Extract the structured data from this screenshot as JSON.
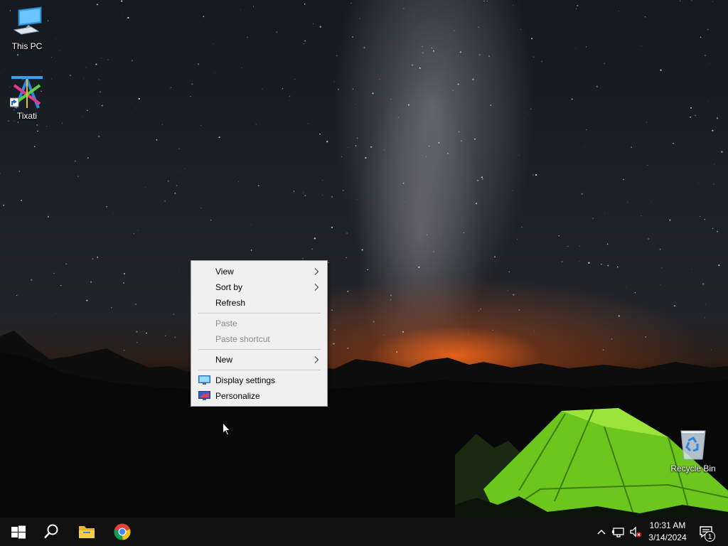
{
  "desktop": {
    "icons": [
      {
        "label": "This PC"
      },
      {
        "label": "Tixati"
      },
      {
        "label": "Recycle Bin"
      }
    ]
  },
  "context_menu": {
    "items": [
      {
        "label": "View",
        "submenu": true,
        "enabled": true
      },
      {
        "label": "Sort by",
        "submenu": true,
        "enabled": true
      },
      {
        "label": "Refresh",
        "submenu": false,
        "enabled": true
      },
      {
        "label": "Paste",
        "submenu": false,
        "enabled": false
      },
      {
        "label": "Paste shortcut",
        "submenu": false,
        "enabled": false
      },
      {
        "label": "New",
        "submenu": true,
        "enabled": true
      },
      {
        "label": "Display settings",
        "icon": "monitor-icon",
        "enabled": true
      },
      {
        "label": "Personalize",
        "icon": "personalize-icon",
        "enabled": true
      }
    ]
  },
  "taskbar": {
    "pinned": [
      "start-icon",
      "search-icon",
      "file-explorer-icon",
      "chrome-icon"
    ],
    "tray": {
      "time": "10:31 AM",
      "date": "3/14/2024",
      "notification_count": "1"
    }
  },
  "colors": {
    "taskbar": "#101010",
    "menu_background": "#f0f0f0",
    "menu_disabled_text": "#8a8a8a",
    "tent": "#7ddc28"
  }
}
